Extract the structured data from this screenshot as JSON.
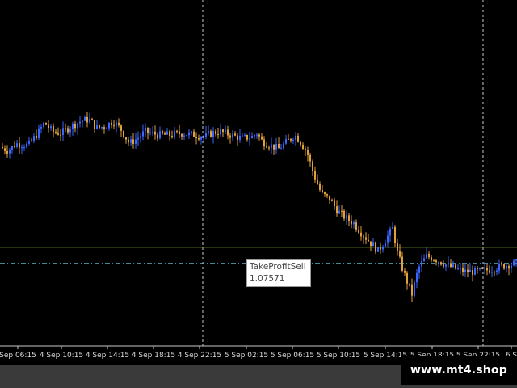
{
  "watermark": {
    "text": "www.mt4.shop"
  },
  "tooltip": {
    "title": "TakeProfitSell",
    "value": "1.07571"
  },
  "colors": {
    "background": "#000000",
    "bull_candle": "#3a66ff",
    "bear_candle": "#e0a13a",
    "take_profit_line": "#9acd32",
    "price_line": "#5fb6c8",
    "grid": "#c8c8c8",
    "axis": "#c8c8c8",
    "bottom_strip": "#3a3a3a"
  },
  "chart_data": {
    "type": "candlestick",
    "x_ticks": [
      "Sep 06:15",
      "4 Sep 10:15",
      "4 Sep 14:15",
      "4 Sep 18:15",
      "4 Sep 22:15",
      "5 Sep 02:15",
      "5 Sep 06:15",
      "5 Sep 10:15",
      "5 Sep 14:15",
      "5 Sep 18:15",
      "5 Sep 22:15",
      "6 S"
    ],
    "levels": [
      {
        "name": "TakeProfitSell",
        "value": 1.07571
      }
    ],
    "price_path": [
      [
        0,
        1.0815
      ],
      [
        10,
        1.0813
      ],
      [
        20,
        1.0817
      ],
      [
        35,
        1.0816
      ],
      [
        45,
        1.0822
      ],
      [
        55,
        1.0829
      ],
      [
        65,
        1.0824
      ],
      [
        75,
        1.0823
      ],
      [
        88,
        1.0827
      ],
      [
        100,
        1.083
      ],
      [
        110,
        1.0831
      ],
      [
        120,
        1.0826
      ],
      [
        130,
        1.0827
      ],
      [
        140,
        1.083
      ],
      [
        150,
        1.0825
      ],
      [
        160,
        1.0817
      ],
      [
        170,
        1.082
      ],
      [
        180,
        1.0824
      ],
      [
        195,
        1.0822
      ],
      [
        210,
        1.0822
      ],
      [
        225,
        1.0823
      ],
      [
        240,
        1.0822
      ],
      [
        252,
        1.0821
      ],
      [
        262,
        1.0823
      ],
      [
        272,
        1.0824
      ],
      [
        285,
        1.0822
      ],
      [
        300,
        1.082
      ],
      [
        312,
        1.0821
      ],
      [
        318,
        1.0823
      ],
      [
        325,
        1.0818
      ],
      [
        335,
        1.0816
      ],
      [
        345,
        1.0814
      ],
      [
        355,
        1.0818
      ],
      [
        365,
        1.0822
      ],
      [
        372,
        1.0818
      ],
      [
        380,
        1.0812
      ],
      [
        390,
        1.0797
      ],
      [
        398,
        1.0788
      ],
      [
        408,
        1.0785
      ],
      [
        418,
        1.0778
      ],
      [
        428,
        1.0774
      ],
      [
        438,
        1.0771
      ],
      [
        448,
        1.0765
      ],
      [
        458,
        1.076
      ],
      [
        468,
        1.0755
      ],
      [
        478,
        1.0762
      ],
      [
        486,
        1.0768
      ],
      [
        492,
        1.0754
      ],
      [
        500,
        1.0742
      ],
      [
        510,
        1.073
      ],
      [
        518,
        1.0745
      ],
      [
        528,
        1.0752
      ],
      [
        540,
        1.075
      ],
      [
        552,
        1.0747
      ],
      [
        562,
        1.0745
      ],
      [
        575,
        1.0743
      ],
      [
        590,
        1.0743
      ],
      [
        605,
        1.0744
      ],
      [
        620,
        1.0746
      ],
      [
        640,
        1.0748
      ]
    ]
  }
}
